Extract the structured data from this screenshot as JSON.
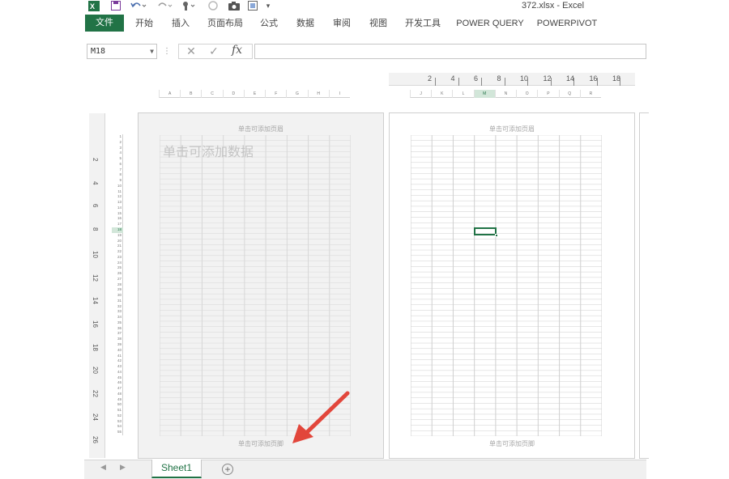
{
  "app": {
    "title": "372.xlsx - Excel",
    "logo_icon": "excel-logo-icon"
  },
  "quick_access": {
    "icons": [
      "save-icon",
      "undo-icon",
      "redo-icon",
      "touch-mode-icon",
      "circle-icon",
      "camera-icon",
      "screenshot-icon",
      "customize-qat-icon"
    ]
  },
  "ribbon": {
    "tabs": [
      "文件",
      "开始",
      "插入",
      "页面布局",
      "公式",
      "数据",
      "审阅",
      "视图",
      "开发工具",
      "POWER QUERY",
      "POWERPIVOT"
    ]
  },
  "formula_bar": {
    "name_box": "M18",
    "cancel_glyph": "✕",
    "enter_glyph": "✓",
    "fx_label": "fx",
    "formula_value": ""
  },
  "ruler": {
    "numbers": [
      "2",
      "4",
      "6",
      "8",
      "10",
      "12",
      "14",
      "16",
      "18"
    ]
  },
  "vertical_ruler": {
    "numbers": [
      "2",
      "4",
      "6",
      "8",
      "10",
      "12",
      "14",
      "16",
      "18",
      "20",
      "22",
      "24",
      "26"
    ]
  },
  "page1": {
    "header_hint": "单击可添加页眉",
    "data_hint": "单击可添加数据",
    "footer_hint": "单击可添加页脚",
    "columns": [
      "A",
      "B",
      "C",
      "D",
      "E",
      "F",
      "G",
      "H",
      "I"
    ]
  },
  "page2": {
    "header_hint": "单击可添加页眉",
    "footer_hint": "单击可添加页脚",
    "columns": [
      "J",
      "K",
      "L",
      "M",
      "N",
      "O",
      "P",
      "Q",
      "R"
    ],
    "selected_column": "M"
  },
  "rows": {
    "count": 55,
    "selected_row": 18
  },
  "sheet_tabs": {
    "tabs": [
      "Sheet1"
    ],
    "active": "Sheet1",
    "add_label": "+"
  },
  "colors": {
    "accent": "#217346",
    "annotation_arrow": "#e2463b"
  }
}
